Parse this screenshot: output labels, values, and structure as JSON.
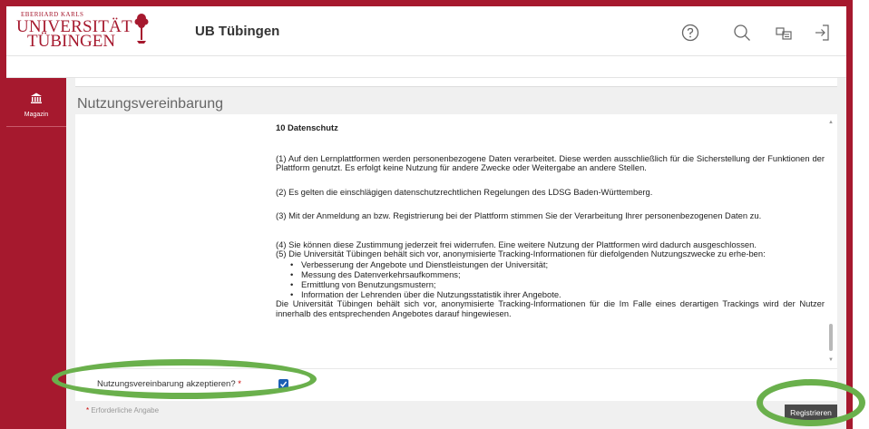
{
  "header": {
    "logo_small": "EBERHARD KARLS",
    "logo_line1": "UNIVERSITÄT",
    "logo_line2": "TÜBINGEN",
    "site_title": "UB Tübingen",
    "icons": [
      "help-icon",
      "search-icon",
      "switch-icon",
      "logout-icon"
    ]
  },
  "sidebar": {
    "items": [
      {
        "label": "Magazin",
        "icon": "bank-icon"
      }
    ]
  },
  "main": {
    "page_title": "Nutzungsvereinbarung",
    "agreement": {
      "heading": "10 Datenschutz",
      "p1": "(1) Auf den Lernplattformen werden personenbezogene Daten verarbeitet. Diese werden ausschließlich für die Sicherstellung der Funktionen der Plattform genutzt. Es erfolgt keine Nutzung für andere Zwecke oder Weitergabe an andere Stellen.",
      "p2": "(2) Es gelten die einschlägigen datenschutzrechtlichen Regelungen des LDSG Baden-Württemberg.",
      "p3": "(3) Mit der Anmeldung an bzw. Registrierung bei der Plattform stimmen Sie der Verarbeitung Ihrer personenbezogenen Daten zu.",
      "p4": "(4) Sie können diese Zustimmung jederzeit frei widerrufen. Eine weitere Nutzung der Plattformen wird dadurch ausgeschlossen.",
      "p5": "(5) Die Universität Tübingen behält sich vor, anonymisierte Tracking-Informationen für diefolgenden Nutzungszwecke zu erhe-ben:",
      "bullets": [
        "Verbesserung der Angebote und Dienstleistungen der Universität;",
        "Messung des Datenverkehrsaufkommens;",
        "Ermittlung von Benutzungsmustern;",
        "Information der Lehrenden über die Nutzungsstatistik ihrer Angebote."
      ],
      "p6": "Die Universität Tübingen behält sich vor, anonymisierte Tracking-Informationen für die Im Falle eines derartigen Trackings wird der Nutzer innerhalb des entsprechenden Angebotes darauf hingewiesen."
    },
    "accept_label": "Nutzungsvereinbarung akzeptieren?",
    "required_mark": "*",
    "accept_checked": true,
    "footer_note": "Erforderliche Angabe",
    "register_button": "Registrieren"
  },
  "colors": {
    "brand_red": "#a6192e",
    "highlight_green": "#6ab04c",
    "checkbox_blue": "#1a5fb4",
    "button_dark": "#4a4a4a"
  }
}
